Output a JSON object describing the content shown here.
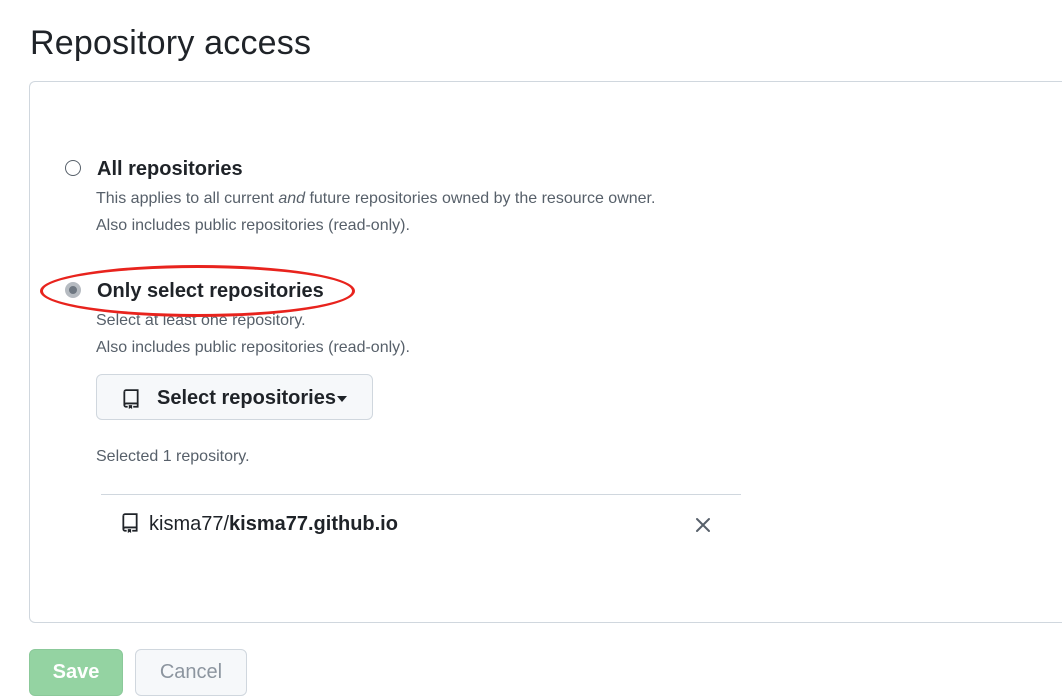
{
  "page": {
    "title": "Repository access"
  },
  "options": {
    "all": {
      "label": "All repositories",
      "desc_line1_pre": "This applies to all current ",
      "desc_line1_em": "and",
      "desc_line1_post": " future repositories owned by the resource owner.",
      "desc_line2": "Also includes public repositories (read-only).",
      "checked": false
    },
    "select": {
      "label": "Only select repositories",
      "desc_line1": "Select at least one repository.",
      "desc_line2": "Also includes public repositories (read-only).",
      "checked": true
    }
  },
  "select_button": {
    "label": "Select repositories",
    "icon": "repo-icon"
  },
  "selected_count": "Selected 1 repository.",
  "repos": [
    {
      "owner": "kisma77/",
      "name": "kisma77.github.io",
      "icon": "repo-icon",
      "remove_icon": "close-icon"
    }
  ],
  "actions": {
    "save_label": "Save",
    "cancel_label": "Cancel"
  },
  "colors": {
    "highlight": "#e8231d",
    "save_bg": "#94d3a2",
    "border": "#d0d7de"
  }
}
